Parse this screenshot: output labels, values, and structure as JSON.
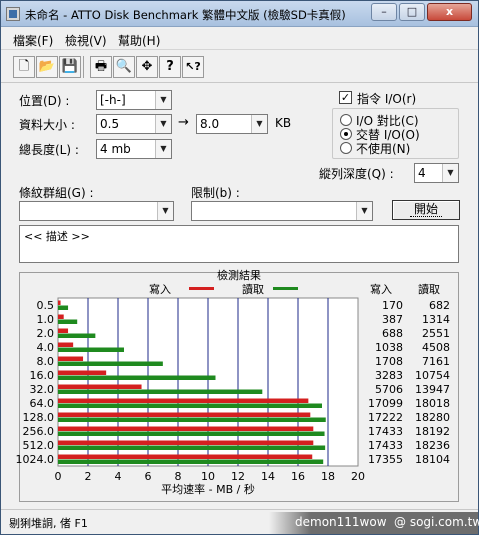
{
  "window": {
    "title": "未命名 - ATTO Disk Benchmark  繁體中文版 (檢驗SD卡真假)",
    "minimize_label": "–",
    "maximize_label": "□",
    "close_label": "x"
  },
  "menu": [
    {
      "label": "檔案(F)"
    },
    {
      "label": "檢視(V)"
    },
    {
      "label": "幫助(H)"
    }
  ],
  "toolbar": {
    "tools": [
      {
        "icon": "new-document-icon",
        "glyph": "🗋"
      },
      {
        "icon": "open-folder-icon",
        "glyph": "📂"
      },
      {
        "icon": "save-icon",
        "glyph": "💾"
      },
      {
        "icon": "print-icon",
        "glyph": "🖶"
      },
      {
        "icon": "print-preview-icon",
        "glyph": "🔍"
      },
      {
        "icon": "move-icon",
        "glyph": "✥"
      },
      {
        "icon": "help-icon",
        "glyph": "?"
      },
      {
        "icon": "context-help-icon",
        "glyph": "↖?"
      }
    ]
  },
  "settings": {
    "drive_label": "位置(D) :",
    "drive_value": "[-h-]",
    "transfer_size_label": "資料大小 :",
    "transfer_from": "0.5",
    "transfer_to": "8.0",
    "transfer_arrow": "→",
    "transfer_unit": "KB",
    "total_length_label": "總長度(L) :",
    "total_length_value": "4 mb",
    "direct_io_label": "指令 I/O(r)",
    "direct_io_checked": "✓",
    "io_options": [
      {
        "label": "I/O 對比(C)",
        "selected": false
      },
      {
        "label": "交替 I/O(O)",
        "selected": true
      },
      {
        "label": "不使用(N)",
        "selected": false
      }
    ],
    "queue_depth_label": "縱列深度(Q) :",
    "queue_depth_value": "4",
    "pattern_label": "條紋群組(G) :",
    "pattern_value": "",
    "limit_label": "限制(b) :",
    "limit_value": "",
    "start_button": "開始",
    "description_text": "<< 描述 >>"
  },
  "results": {
    "title": "檢測結果",
    "write_legend": "寫入",
    "read_legend": "讀取",
    "write_col_header": "寫入",
    "read_col_header": "讀取",
    "write_color": "#d42020",
    "read_color": "#1f8a1f"
  },
  "chart_data": {
    "type": "bar",
    "orientation": "horizontal",
    "title": "檢測結果",
    "xlabel": "平均速率 - MB / 秒",
    "xlim": [
      0,
      20
    ],
    "xticks": [
      "0",
      "2",
      "4",
      "6",
      "8",
      "10",
      "12",
      "14",
      "16",
      "18",
      "20"
    ],
    "categories": [
      "0.5",
      "1.0",
      "2.0",
      "4.0",
      "8.0",
      "16.0",
      "32.0",
      "64.0",
      "128.0",
      "256.0",
      "512.0",
      "1024.0"
    ],
    "series": [
      {
        "name": "寫入",
        "values": [
          0.17,
          0.38,
          0.67,
          1.01,
          1.67,
          3.21,
          5.57,
          16.69,
          16.82,
          17.02,
          17.02,
          16.95
        ],
        "labels": [
          "170",
          "387",
          "688",
          "1038",
          "1708",
          "3283",
          "5706",
          "17099",
          "17222",
          "17433",
          "17433",
          "17355"
        ]
      },
      {
        "name": "讀取",
        "values": [
          0.67,
          1.28,
          2.49,
          4.4,
          6.99,
          10.5,
          13.62,
          17.6,
          17.85,
          17.77,
          17.81,
          17.68
        ],
        "labels": [
          "682",
          "1314",
          "2551",
          "4508",
          "7161",
          "10754",
          "13947",
          "18018",
          "18280",
          "18192",
          "18236",
          "18104"
        ]
      }
    ]
  },
  "status": {
    "text": "剔猁堆詷,  偖 F1"
  },
  "watermark": {
    "left": "demon111wow",
    "right": "@ sogi.com.tw"
  }
}
